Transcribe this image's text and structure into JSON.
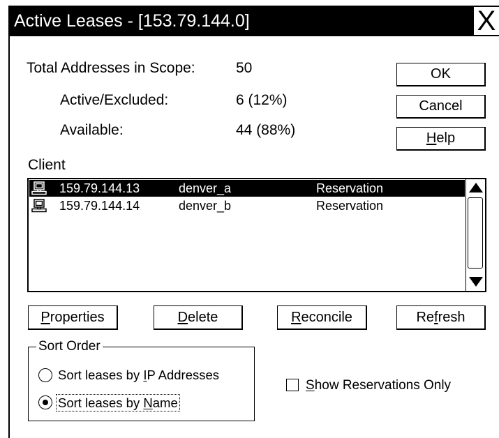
{
  "window": {
    "title": "Active Leases - [153.79.144.0]",
    "close_label": "X"
  },
  "summary": {
    "total": {
      "label": "Total Addresses in Scope:",
      "value": "50"
    },
    "active": {
      "label": "Active/Excluded:",
      "value": "6 (12%)"
    },
    "available": {
      "label": "Available:",
      "value": "44 (88%)"
    }
  },
  "buttons": {
    "ok": {
      "label": "OK"
    },
    "cancel": {
      "label": "Cancel"
    },
    "help": {
      "label": "Help",
      "accel": "H"
    },
    "properties": {
      "label": "Properties",
      "accel": "P"
    },
    "delete": {
      "label": "Delete",
      "accel": "D"
    },
    "reconcile": {
      "label": "Reconcile",
      "accel": "R"
    },
    "refresh": {
      "label": "Refresh",
      "accel": "f"
    }
  },
  "client": {
    "label": "Client",
    "rows": [
      {
        "icon": "computer-icon",
        "ip": "159.79.144.13",
        "name": "denver_a",
        "type": "Reservation",
        "selected": true
      },
      {
        "icon": "computer-icon",
        "ip": "159.79.144.14",
        "name": "denver_b",
        "type": "Reservation",
        "selected": false
      }
    ]
  },
  "sort_order": {
    "label": "Sort Order",
    "options": [
      {
        "label": "Sort leases by IP Addresses",
        "accel": "I",
        "checked": false
      },
      {
        "label": "Sort leases by Name",
        "accel": "N",
        "checked": true
      }
    ]
  },
  "show_reservations_only": {
    "label": "Show Reservations Only",
    "accel": "S",
    "checked": false
  },
  "colors": {
    "title_bar": "#000000",
    "selected_row": "#000000",
    "window": "#ffffff"
  }
}
